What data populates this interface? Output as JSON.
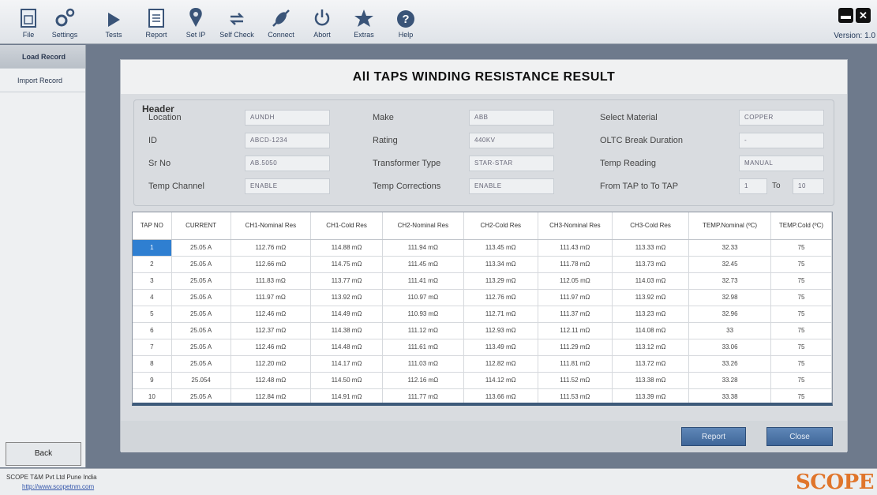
{
  "toolbar": {
    "items": [
      {
        "label": "File",
        "icon": "file-icon"
      },
      {
        "label": "Settings",
        "icon": "gear-icon"
      },
      {
        "label": "Tests",
        "icon": "play-icon"
      },
      {
        "label": "Report",
        "icon": "report-icon"
      },
      {
        "label": "Set IP",
        "icon": "location-pin-icon"
      },
      {
        "label": "Self Check",
        "icon": "refresh-arrows-icon"
      },
      {
        "label": "Connect",
        "icon": "plug-icon"
      },
      {
        "label": "Abort",
        "icon": "power-icon"
      },
      {
        "label": "Extras",
        "icon": "star-icon"
      },
      {
        "label": "Help",
        "icon": "help-icon"
      }
    ],
    "version": "Version: 1.0"
  },
  "sidebar": {
    "items": [
      {
        "label": "Load Record",
        "active": true
      },
      {
        "label": "Import Record",
        "active": false
      }
    ],
    "back_label": "Back"
  },
  "panel": {
    "title": "All TAPS WINDING RESISTANCE RESULT",
    "header": {
      "legend": "Header",
      "location_label": "Location",
      "location_value": "AUNDH",
      "id_label": "ID",
      "id_value": "ABCD-1234",
      "srno_label": "Sr No",
      "srno_value": "AB.5050",
      "tempchannel_label": "Temp Channel",
      "tempchannel_value": "ENABLE",
      "make_label": "Make",
      "make_value": "ABB",
      "rating_label": "Rating",
      "rating_value": "440KV",
      "transformer_label": "Transformer Type",
      "transformer_value": "STAR-STAR",
      "tempcorr_label": "Temp Corrections",
      "tempcorr_value": "ENABLE",
      "material_label": "Select Material",
      "material_value": "COPPER",
      "oltc_label": "OLTC Break Duration",
      "oltc_value": "-",
      "tempreading_label": "Temp Reading",
      "tempreading_value": "MANUAL",
      "tap_label": "From TAP to To TAP",
      "tap_from": "1",
      "tap_to_label": "To",
      "tap_to": "10"
    },
    "table": {
      "columns": [
        "TAP NO",
        "CURRENT",
        "CH1-Nominal Res",
        "CH1-Cold Res",
        "CH2-Nominal Res",
        "CH2-Cold Res",
        "CH3-Nominal Res",
        "CH3-Cold Res",
        "TEMP.Nominal (ºC)",
        "TEMP.Cold (ºC)"
      ],
      "rows": [
        [
          "1",
          "25.05 A",
          "112.76 mΩ",
          "114.88 mΩ",
          "111.94 mΩ",
          "113.45 mΩ",
          "111.43 mΩ",
          "113.33 mΩ",
          "32.33",
          "75"
        ],
        [
          "2",
          "25.05 A",
          "112.66 mΩ",
          "114.75 mΩ",
          "111.45 mΩ",
          "113.34 mΩ",
          "111.78 mΩ",
          "113.73 mΩ",
          "32.45",
          "75"
        ],
        [
          "3",
          "25.05 A",
          "111.83 mΩ",
          "113.77 mΩ",
          "111.41 mΩ",
          "113.29 mΩ",
          "112.05 mΩ",
          "114.03 mΩ",
          "32.73",
          "75"
        ],
        [
          "4",
          "25.05 A",
          "111.97 mΩ",
          "113.92 mΩ",
          "110.97 mΩ",
          "112.76 mΩ",
          "111.97 mΩ",
          "113.92 mΩ",
          "32.98",
          "75"
        ],
        [
          "5",
          "25.05 A",
          "112.46 mΩ",
          "114.49 mΩ",
          "110.93 mΩ",
          "112.71 mΩ",
          "111.37 mΩ",
          "113.23 mΩ",
          "32.96",
          "75"
        ],
        [
          "6",
          "25.05 A",
          "112.37 mΩ",
          "114.38 mΩ",
          "111.12 mΩ",
          "112.93 mΩ",
          "112.11 mΩ",
          "114.08 mΩ",
          "33",
          "75"
        ],
        [
          "7",
          "25.05 A",
          "112.46 mΩ",
          "114.48 mΩ",
          "111.61 mΩ",
          "113.49 mΩ",
          "111.29 mΩ",
          "113.12 mΩ",
          "33.06",
          "75"
        ],
        [
          "8",
          "25.05 A",
          "112.20 mΩ",
          "114.17 mΩ",
          "111.03 mΩ",
          "112.82 mΩ",
          "111.81 mΩ",
          "113.72 mΩ",
          "33.26",
          "75"
        ],
        [
          "9",
          "25.054",
          "112.48 mΩ",
          "114.50 mΩ",
          "112.16 mΩ",
          "114.12 mΩ",
          "111.52 mΩ",
          "113.38 mΩ",
          "33.28",
          "75"
        ],
        [
          "10",
          "25.05 A",
          "112.84 mΩ",
          "114.91 mΩ",
          "111.77 mΩ",
          "113.66 mΩ",
          "111.53 mΩ",
          "113.39 mΩ",
          "33.38",
          "75"
        ]
      ],
      "selected_color": "#2f7fd1"
    },
    "report_label": "Report",
    "close_label": "Close"
  },
  "status": {
    "company": "SCOPE T&M Pvt Ltd Pune India",
    "url": "http://www.scopetnm.com",
    "logo": "SCOPE"
  },
  "colors": {
    "accent": "#3f6698",
    "logo": "#e0752b"
  }
}
